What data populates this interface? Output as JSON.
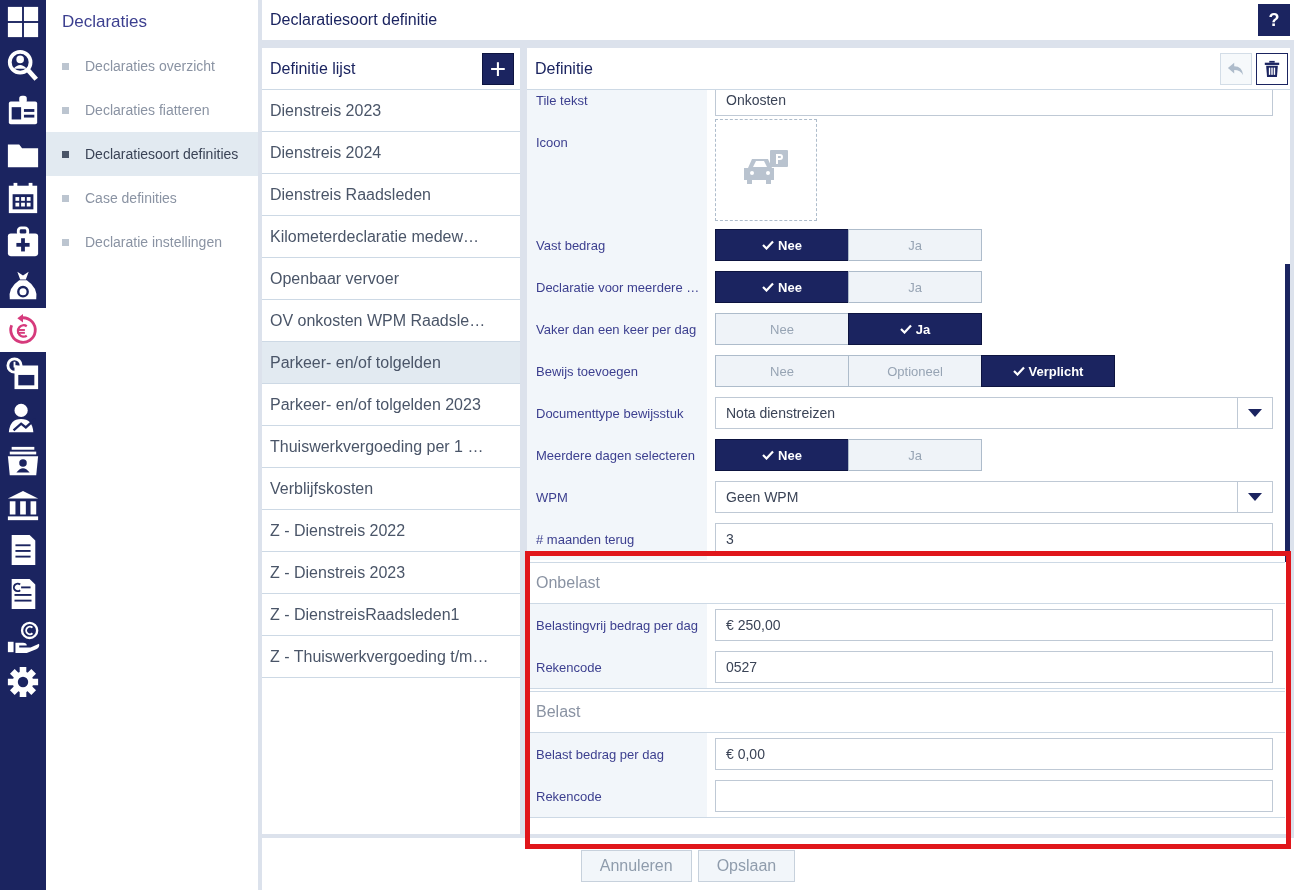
{
  "rail_icons": [
    {
      "selected": false
    },
    {
      "selected": false
    },
    {
      "selected": false
    },
    {
      "selected": false
    },
    {
      "selected": false
    },
    {
      "selected": false
    },
    {
      "selected": false
    },
    {
      "selected": true
    },
    {
      "selected": false
    },
    {
      "selected": false
    },
    {
      "selected": false
    },
    {
      "selected": false
    },
    {
      "selected": false
    },
    {
      "selected": false
    },
    {
      "selected": false
    },
    {
      "selected": false
    }
  ],
  "submenu": {
    "title": "Declaraties",
    "items": [
      {
        "label": "Declaraties overzicht",
        "selected": false
      },
      {
        "label": "Declaraties fiatteren",
        "selected": false
      },
      {
        "label": "Declaratiesoort definities",
        "selected": true
      },
      {
        "label": "Case definities",
        "selected": false
      },
      {
        "label": "Declaratie instellingen",
        "selected": false
      }
    ]
  },
  "header": {
    "title": "Declaratiesoort definitie",
    "help": "?"
  },
  "list": {
    "title": "Definitie lijst",
    "add": "+",
    "items": [
      {
        "label": "Dienstreis 2023",
        "selected": false
      },
      {
        "label": "Dienstreis 2024",
        "selected": false
      },
      {
        "label": "Dienstreis Raadsleden",
        "selected": false
      },
      {
        "label": "Kilometerdeclaratie medew…",
        "selected": false
      },
      {
        "label": "Openbaar vervoer",
        "selected": false
      },
      {
        "label": "OV onkosten WPM Raadsle…",
        "selected": false
      },
      {
        "label": "Parkeer- en/of tolgelden",
        "selected": true
      },
      {
        "label": "Parkeer- en/of tolgelden 2023",
        "selected": false
      },
      {
        "label": "Thuiswerkvergoeding per 1 …",
        "selected": false
      },
      {
        "label": "Verblijfskosten",
        "selected": false
      },
      {
        "label": "Z - Dienstreis 2022",
        "selected": false
      },
      {
        "label": "Z - Dienstreis 2023",
        "selected": false
      },
      {
        "label": "Z - DienstreisRaadsleden1",
        "selected": false
      },
      {
        "label": "Z - Thuiswerkvergoeding t/m…",
        "selected": false
      }
    ]
  },
  "definition": {
    "title": "Definitie",
    "undo_disabled": true,
    "fields": [
      {
        "kind": "text",
        "label": "Tile tekst",
        "value": "Onkosten"
      },
      {
        "kind": "icon",
        "label": "Icoon"
      },
      {
        "kind": "toggle",
        "label": "Vast bedrag",
        "options": [
          {
            "label": "Nee",
            "selected": true
          },
          {
            "label": "Ja",
            "selected": false
          }
        ]
      },
      {
        "kind": "toggle",
        "label": "Declaratie voor meerdere …",
        "options": [
          {
            "label": "Nee",
            "selected": true
          },
          {
            "label": "Ja",
            "selected": false
          }
        ]
      },
      {
        "kind": "toggle",
        "label": "Vaker dan een keer per dag",
        "options": [
          {
            "label": "Nee",
            "selected": false
          },
          {
            "label": "Ja",
            "selected": true
          }
        ]
      },
      {
        "kind": "toggle",
        "label": "Bewijs toevoegen",
        "options": [
          {
            "label": "Nee",
            "selected": false
          },
          {
            "label": "Optioneel",
            "selected": false
          },
          {
            "label": "Verplicht",
            "selected": true
          }
        ]
      },
      {
        "kind": "select",
        "label": "Documenttype bewijsstuk",
        "value": "Nota dienstreizen"
      },
      {
        "kind": "toggle",
        "label": "Meerdere dagen selecteren",
        "options": [
          {
            "label": "Nee",
            "selected": true
          },
          {
            "label": "Ja",
            "selected": false
          }
        ]
      },
      {
        "kind": "select",
        "label": "WPM",
        "value": "Geen WPM"
      },
      {
        "kind": "text",
        "label": "# maanden terug",
        "value": "3"
      }
    ],
    "sections": [
      {
        "title": "Onbelast",
        "fields": [
          {
            "kind": "text",
            "label": "Belastingvrij bedrag per dag",
            "value": "€ 250,00"
          },
          {
            "kind": "text",
            "label": "Rekencode",
            "value": "0527"
          }
        ]
      },
      {
        "title": "Belast",
        "fields": [
          {
            "kind": "text",
            "label": "Belast bedrag per dag",
            "value": "€ 0,00"
          },
          {
            "kind": "text",
            "label": "Rekencode"
          }
        ]
      }
    ]
  },
  "footer": {
    "buttons": [
      {
        "label": "Annuleren",
        "disabled": true
      },
      {
        "label": "Opslaan",
        "disabled": true
      }
    ]
  }
}
